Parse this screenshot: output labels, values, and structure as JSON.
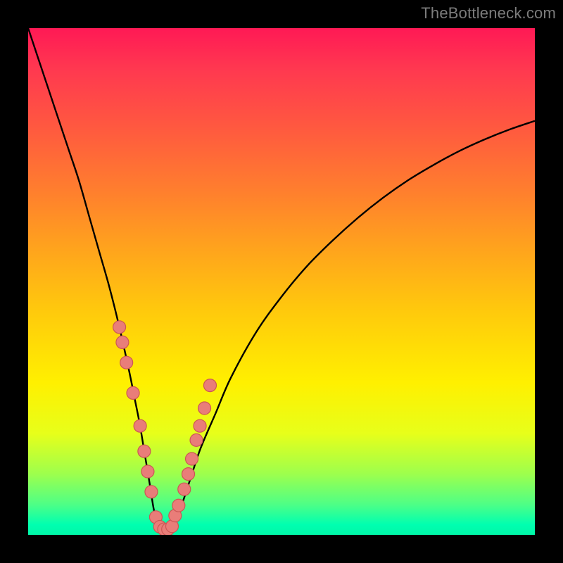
{
  "watermark": "TheBottleneck.com",
  "colors": {
    "background": "#000000",
    "curve_stroke": "#000000",
    "marker_fill": "#e97d79",
    "marker_stroke": "#cc5654"
  },
  "chart_data": {
    "type": "line",
    "title": "",
    "xlabel": "",
    "ylabel": "",
    "xlim": [
      0,
      100
    ],
    "ylim": [
      0,
      100
    ],
    "grid": false,
    "series": [
      {
        "name": "bottleneck-curve",
        "x": [
          0,
          2,
          4,
          6,
          8,
          10,
          12,
          14,
          16,
          18,
          20,
          21,
          22,
          23,
          24,
          24.8,
          25.6,
          26.4,
          27.3,
          28.7,
          30,
          32,
          34,
          37,
          40,
          45,
          50,
          55,
          60,
          65,
          70,
          75,
          80,
          85,
          90,
          95,
          100
        ],
        "values": [
          100,
          94,
          88,
          82,
          76,
          70,
          63,
          56,
          49,
          41,
          32,
          27,
          22,
          16,
          10,
          5,
          2.2,
          1.0,
          1.0,
          2.0,
          5,
          11,
          17,
          24,
          31,
          40,
          47,
          53,
          58,
          62.5,
          66.5,
          70,
          73,
          75.7,
          78,
          80,
          81.7
        ]
      }
    ],
    "markers": {
      "name": "highlighted-points",
      "x": [
        18.0,
        18.6,
        19.4,
        20.7,
        22.1,
        22.9,
        23.6,
        24.3,
        25.2,
        26.0,
        26.8,
        27.6,
        28.4,
        29.0,
        29.7,
        30.8,
        31.6,
        32.3,
        33.2,
        33.9,
        34.8,
        35.9
      ],
      "values": [
        41.0,
        38.0,
        34.0,
        28.0,
        21.5,
        16.5,
        12.5,
        8.5,
        3.5,
        1.6,
        1.1,
        1.1,
        1.7,
        3.8,
        5.8,
        9.0,
        12.0,
        15.0,
        18.7,
        21.5,
        25.0,
        29.5
      ]
    }
  }
}
